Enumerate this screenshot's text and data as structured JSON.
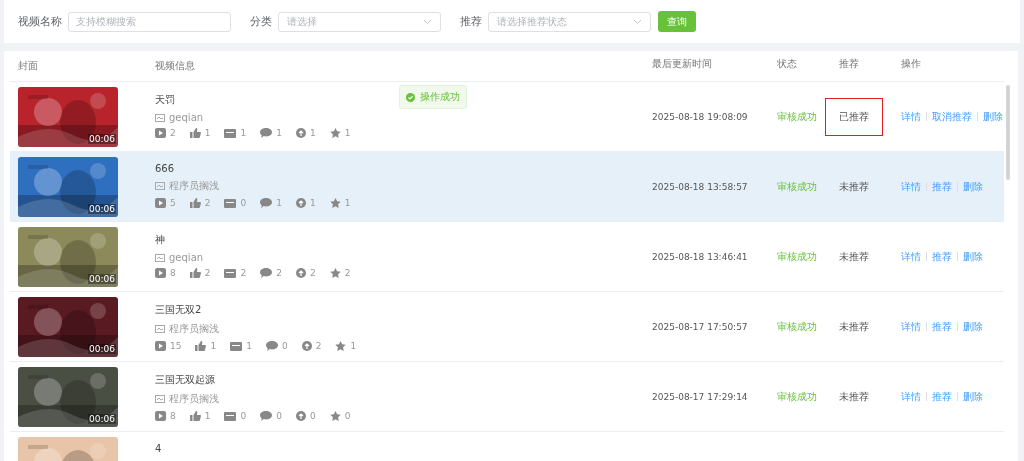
{
  "filters": [
    {
      "label": "视频名称",
      "kind": "input",
      "placeholder": "支持模糊搜索"
    },
    {
      "label": "分类",
      "kind": "select",
      "placeholder": "请选择"
    },
    {
      "label": "推荐",
      "kind": "select",
      "placeholder": "请选择推荐状态"
    }
  ],
  "query_button": "查询",
  "table": {
    "columns": [
      "封面",
      "视频信息",
      "最后更新时间",
      "状态",
      "推荐",
      "操作"
    ],
    "rows": [
      {
        "selected": false,
        "duration": "00:06",
        "title": "天罚",
        "author": "geqian",
        "stats": [
          {
            "kind": "plays",
            "value": "2"
          },
          {
            "kind": "likes",
            "value": "1"
          },
          {
            "kind": "danmaku",
            "value": "1"
          },
          {
            "kind": "comments",
            "value": "1"
          },
          {
            "kind": "coins",
            "value": "1"
          },
          {
            "kind": "favorites",
            "value": "1"
          }
        ],
        "updated": "2025-08-18 19:08:09",
        "status": "审核成功",
        "recommend": "已推荐",
        "highlighted": true,
        "actions": [
          "详情",
          "取消推荐",
          "删除"
        ]
      },
      {
        "selected": true,
        "duration": "00:06",
        "title": "666",
        "author": "程序员搁浅",
        "stats": [
          {
            "kind": "plays",
            "value": "5"
          },
          {
            "kind": "likes",
            "value": "2"
          },
          {
            "kind": "danmaku",
            "value": "0"
          },
          {
            "kind": "comments",
            "value": "1"
          },
          {
            "kind": "coins",
            "value": "1"
          },
          {
            "kind": "favorites",
            "value": "1"
          }
        ],
        "updated": "2025-08-18 13:58:57",
        "status": "审核成功",
        "recommend": "未推荐",
        "highlighted": false,
        "actions": [
          "详情",
          "推荐",
          "删除"
        ]
      },
      {
        "selected": false,
        "duration": "00:06",
        "title": "神",
        "author": "geqian",
        "stats": [
          {
            "kind": "plays",
            "value": "8"
          },
          {
            "kind": "likes",
            "value": "2"
          },
          {
            "kind": "danmaku",
            "value": "2"
          },
          {
            "kind": "comments",
            "value": "2"
          },
          {
            "kind": "coins",
            "value": "2"
          },
          {
            "kind": "favorites",
            "value": "2"
          }
        ],
        "updated": "2025-08-18 13:46:41",
        "status": "审核成功",
        "recommend": "未推荐",
        "highlighted": false,
        "actions": [
          "详情",
          "推荐",
          "删除"
        ]
      },
      {
        "selected": false,
        "duration": "00:06",
        "title": "三国无双2",
        "author": "程序员搁浅",
        "stats": [
          {
            "kind": "plays",
            "value": "15"
          },
          {
            "kind": "likes",
            "value": "1"
          },
          {
            "kind": "danmaku",
            "value": "1"
          },
          {
            "kind": "comments",
            "value": "0"
          },
          {
            "kind": "coins",
            "value": "2"
          },
          {
            "kind": "favorites",
            "value": "1"
          }
        ],
        "updated": "2025-08-17 17:50:57",
        "status": "审核成功",
        "recommend": "未推荐",
        "highlighted": false,
        "actions": [
          "详情",
          "推荐",
          "删除"
        ]
      },
      {
        "selected": false,
        "duration": "00:06",
        "title": "三国无双起源",
        "author": "程序员搁浅",
        "stats": [
          {
            "kind": "plays",
            "value": "8"
          },
          {
            "kind": "likes",
            "value": "1"
          },
          {
            "kind": "danmaku",
            "value": "0"
          },
          {
            "kind": "comments",
            "value": "0"
          },
          {
            "kind": "coins",
            "value": "0"
          },
          {
            "kind": "favorites",
            "value": "0"
          }
        ],
        "updated": "2025-08-17 17:29:14",
        "status": "审核成功",
        "recommend": "未推荐",
        "highlighted": false,
        "actions": [
          "详情",
          "推荐",
          "删除"
        ]
      },
      {
        "selected": false,
        "title": "4"
      }
    ]
  },
  "toast": {
    "message": "操作成功"
  }
}
